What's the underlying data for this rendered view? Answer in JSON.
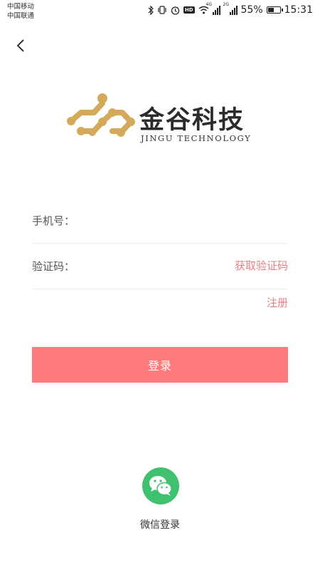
{
  "status_bar": {
    "carrier_1": "中国移动",
    "carrier_2": "中国联通",
    "battery_percent": "55%",
    "battery_level": 0.55,
    "time": "15:31",
    "hd_badge": "HD",
    "signal_1_tag": "4G",
    "signal_2_tag": "2G",
    "icons": [
      "bluetooth-icon",
      "vibrate-icon",
      "alarm-icon",
      "hd-icon",
      "wifi-icon",
      "signal-icon",
      "battery-icon"
    ]
  },
  "logo": {
    "title": "金谷科技",
    "subtitle": "JINGU TECHNOLOGY",
    "color": "#d4aa5a"
  },
  "form": {
    "phone_label": "手机号：",
    "phone_value": "",
    "code_label": "验证码：",
    "code_value": "",
    "get_code_label": "获取验证码",
    "register_label": "注册",
    "login_label": "登录"
  },
  "wechat": {
    "label": "微信登录",
    "icon": "wechat-icon",
    "color": "#3fc170"
  },
  "colors": {
    "accent": "#ff7b7b",
    "link": "#ee7e7e"
  }
}
